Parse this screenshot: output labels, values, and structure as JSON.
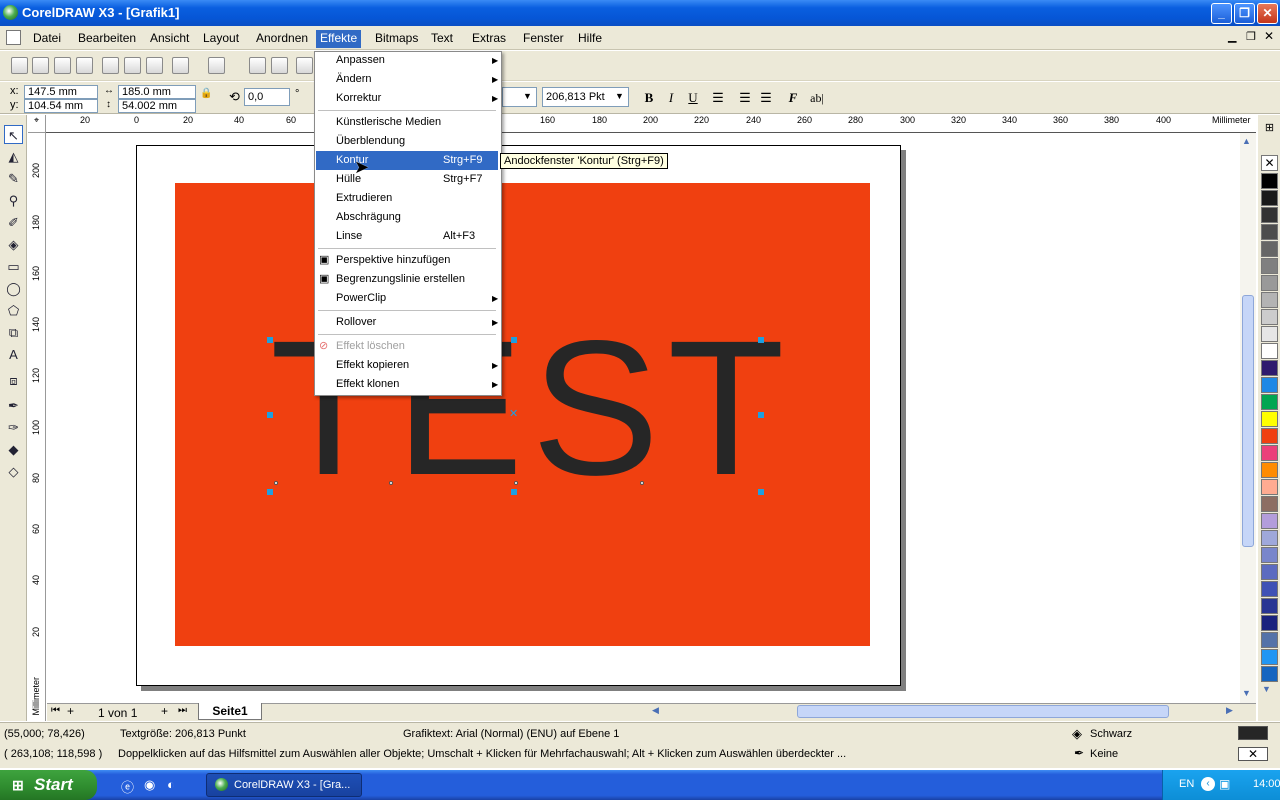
{
  "window": {
    "title": "CorelDRAW X3 - [Grafik1]",
    "minimize": "_",
    "restore": "❐",
    "close": "✕"
  },
  "menubar": {
    "items": [
      "Datei",
      "Bearbeiten",
      "Ansicht",
      "Layout",
      "Anordnen",
      "Effekte",
      "Bitmaps",
      "Text",
      "Extras",
      "Fenster",
      "Hilfe"
    ],
    "active": "Effekte"
  },
  "propbar": {
    "x": "147.5 mm",
    "y": "104.54 mm",
    "width": "185.0 mm",
    "height": "54.002 mm",
    "rotation": "0,0",
    "degree_sym": "°",
    "font_size": "206,813 Pkt",
    "bold": "B",
    "italic": "I",
    "underline": "U",
    "font_btn": "F",
    "ab_btn": "ab|"
  },
  "ruler": {
    "unit": "Millimeter",
    "h_ticks": [
      "20",
      "0",
      "20",
      "40",
      "60",
      "160",
      "180",
      "200",
      "220",
      "240",
      "260",
      "280",
      "300",
      "320",
      "340",
      "360",
      "380",
      "400"
    ],
    "v_ticks": [
      "200",
      "180",
      "160",
      "140",
      "120",
      "100",
      "80",
      "60",
      "40",
      "20"
    ]
  },
  "canvas": {
    "text": "TEST"
  },
  "effects_menu": [
    {
      "label": "Anpassen",
      "shortcut": "",
      "submenu": true
    },
    {
      "label": "Ändern",
      "shortcut": "",
      "submenu": true
    },
    {
      "label": "Korrektur",
      "shortcut": "",
      "submenu": true
    },
    {
      "label": "Künstlerische Medien",
      "shortcut": "",
      "submenu": false
    },
    {
      "label": "Überblendung",
      "shortcut": "",
      "submenu": false
    },
    {
      "label": "Kontur",
      "shortcut": "Strg+F9",
      "submenu": false
    },
    {
      "label": "Hülle",
      "shortcut": "Strg+F7",
      "submenu": false
    },
    {
      "label": "Extrudieren",
      "shortcut": "",
      "submenu": false
    },
    {
      "label": "Abschrägung",
      "shortcut": "",
      "submenu": false
    },
    {
      "label": "Linse",
      "shortcut": "Alt+F3",
      "submenu": false
    },
    {
      "label": "Perspektive hinzufügen",
      "shortcut": "",
      "submenu": false
    },
    {
      "label": "Begrenzungslinie erstellen",
      "shortcut": "",
      "submenu": false
    },
    {
      "label": "PowerClip",
      "shortcut": "",
      "submenu": true
    },
    {
      "label": "Rollover",
      "shortcut": "",
      "submenu": true
    },
    {
      "label": "Effekt löschen",
      "shortcut": "",
      "submenu": false
    },
    {
      "label": "Effekt kopieren",
      "shortcut": "",
      "submenu": true
    },
    {
      "label": "Effekt klonen",
      "shortcut": "",
      "submenu": true
    }
  ],
  "tooltip": "Andockfenster 'Kontur' (Strg+F9)",
  "page_nav": {
    "page_count": "1 von 1",
    "tab": "Seite1"
  },
  "status": {
    "coords1": "(55,000; 78,426)",
    "text_size": "Textgröße: 206,813 Punkt",
    "object_info": "Grafiktext: Arial (Normal) (ENU) auf Ebene 1",
    "fill": "Schwarz",
    "outline": "Keine",
    "coords2": "( 263,108; 118,598 )",
    "hint": "Doppelklicken auf das Hilfsmittel zum Auswählen aller Objekte; Umschalt + Klicken für Mehrfachauswahl; Alt + Klicken zum Auswählen überdeckter ..."
  },
  "taskbar": {
    "start": "Start",
    "task": "CorelDRAW X3 - [Gra...",
    "lang": "EN",
    "clock": "14:00"
  },
  "palette_colors": [
    "#000000",
    "#1a1a1a",
    "#333333",
    "#4d4d4d",
    "#666666",
    "#808080",
    "#999999",
    "#b3b3b3",
    "#cccccc",
    "#e6e6e6",
    "#ffffff",
    "#2e1a6e",
    "#1e88e5",
    "#00a651",
    "#ffff00",
    "#f04010",
    "#ec407a",
    "#ff8c00",
    "#ffab91",
    "#8d6e63",
    "#b39ddb",
    "#9fa8da",
    "#7986cb",
    "#5c6bc0",
    "#3f51b5",
    "#283593",
    "#1a237e",
    "#5472a8",
    "#2196f3",
    "#1565c0"
  ],
  "colors": {
    "fill": "#f04010",
    "text": "#262626",
    "handles": "#1e9fe0",
    "accent": "#316ac5"
  }
}
